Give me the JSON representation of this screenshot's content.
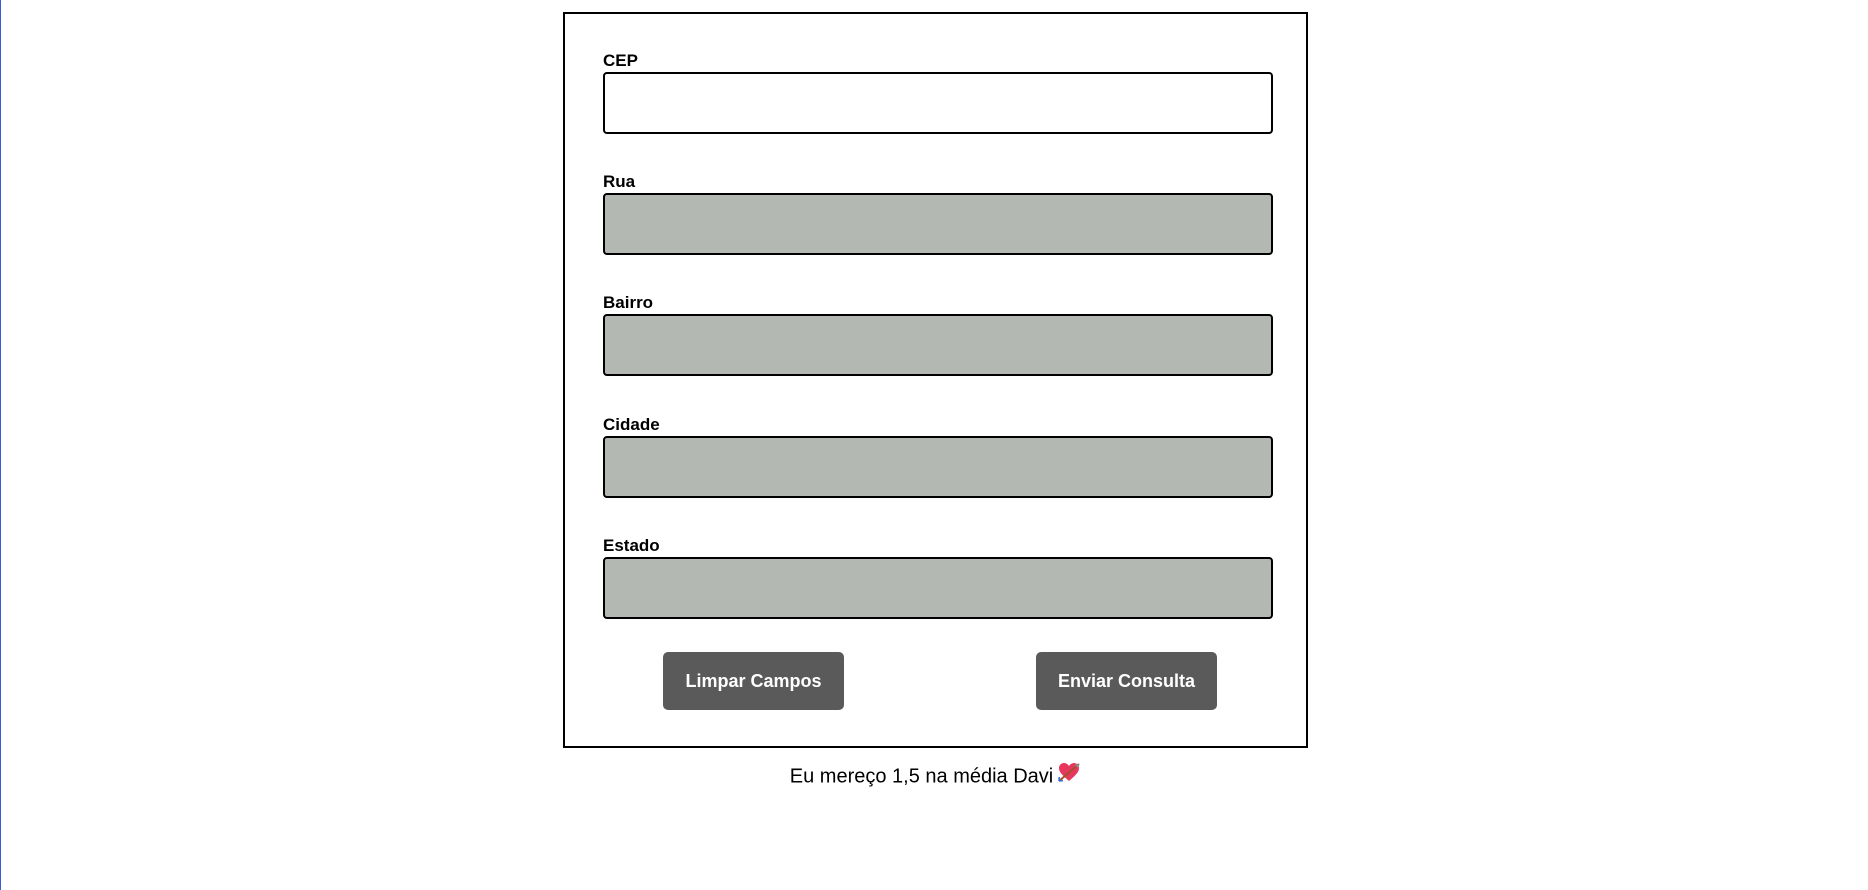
{
  "form": {
    "fields": [
      {
        "label": "CEP",
        "value": "",
        "readonly": false
      },
      {
        "label": "Rua",
        "value": "",
        "readonly": true
      },
      {
        "label": "Bairro",
        "value": "",
        "readonly": true
      },
      {
        "label": "Cidade",
        "value": "",
        "readonly": true
      },
      {
        "label": "Estado",
        "value": "",
        "readonly": true
      }
    ],
    "buttons": {
      "clear_label": "Limpar Campos",
      "submit_label": "Enviar Consulta"
    }
  },
  "footer": {
    "text": "Eu mereço 1,5 na média Davi",
    "icon": "heart-arrow-icon"
  },
  "colors": {
    "editable_bg": "#ffffff",
    "readonly_bg": "#b4b8b3",
    "button_bg": "#5a5a5a",
    "heart": "#e8375d"
  }
}
